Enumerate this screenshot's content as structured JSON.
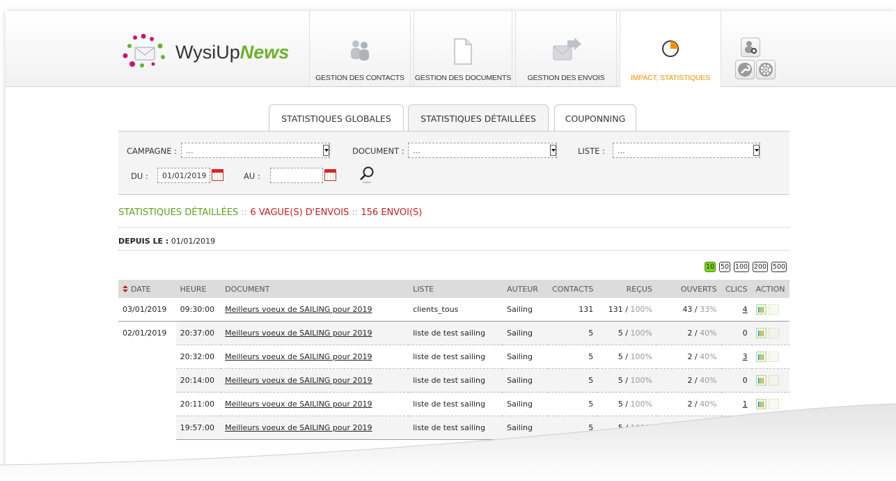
{
  "header": {
    "logo_text_main": "WysiUp",
    "logo_text_brand": "News",
    "nav": [
      {
        "label": "GESTION DES CONTACTS",
        "icon": "contacts-icon"
      },
      {
        "label": "GESTION DES DOCUMENTS",
        "icon": "document-icon"
      },
      {
        "label": "GESTION DES ENVOIS",
        "icon": "send-icon"
      },
      {
        "label": "IMPACT, STATISTIQUES",
        "icon": "pie-chart-icon",
        "active": true
      }
    ],
    "tools": [
      "user-add-icon",
      "wrench-icon",
      "gear-icon"
    ]
  },
  "subtabs": [
    {
      "label": "STATISTIQUES GLOBALES"
    },
    {
      "label": "STATISTIQUES DÉTAILLÉES",
      "active": true
    },
    {
      "label": "COUPONNING"
    }
  ],
  "filters": {
    "campagne_label": "CAMPAGNE :",
    "campagne_value": "...",
    "document_label": "DOCUMENT :",
    "document_value": "...",
    "liste_label": "LISTE :",
    "liste_value": "...",
    "du_label": "DU :",
    "du_value": "01/01/2019",
    "au_label": "AU :",
    "au_value": ""
  },
  "summary": {
    "title": "STATISTIQUES DÉTAILLÉES",
    "sep": "::",
    "waves": "6 VAGUE(S) D'ENVOIS",
    "sends": "156 ENVOI(S)"
  },
  "since": {
    "label": "DEPUIS LE :",
    "value": "01/01/2019"
  },
  "pager": [
    "10",
    "50",
    "100",
    "200",
    "500"
  ],
  "pager_active": "10",
  "table": {
    "headers": {
      "date": "DATE",
      "heure": "HEURE",
      "document": "DOCUMENT",
      "liste": "LISTE",
      "auteur": "AUTEUR",
      "contacts": "CONTACTS",
      "recus": "REÇUS",
      "ouverts": "OUVERTS",
      "clics": "CLICS",
      "action": "ACTION"
    },
    "rows": [
      {
        "date": "03/01/2019",
        "heure": "09:30:00",
        "document": "Meilleurs voeux de SAILING pour 2019",
        "liste": "clients_tous",
        "auteur": "Sailing",
        "contacts": "131",
        "recus_n": "131",
        "recus_p": "100%",
        "ouverts_n": "43",
        "ouverts_p": "33%",
        "clics": "4"
      },
      {
        "date": "02/01/2019",
        "heure": "20:37:00",
        "document": "Meilleurs voeux de SAILING pour 2019",
        "liste": "liste de test sailing",
        "auteur": "Sailing",
        "contacts": "5",
        "recus_n": "5",
        "recus_p": "100%",
        "ouverts_n": "2",
        "ouverts_p": "40%",
        "clics": "0"
      },
      {
        "date": "",
        "heure": "20:32:00",
        "document": "Meilleurs voeux de SAILING pour 2019",
        "liste": "liste de test sailing",
        "auteur": "Sailing",
        "contacts": "5",
        "recus_n": "5",
        "recus_p": "100%",
        "ouverts_n": "2",
        "ouverts_p": "40%",
        "clics": "3"
      },
      {
        "date": "",
        "heure": "20:14:00",
        "document": "Meilleurs voeux de SAILING pour 2019",
        "liste": "liste de test sailing",
        "auteur": "Sailing",
        "contacts": "5",
        "recus_n": "5",
        "recus_p": "100%",
        "ouverts_n": "2",
        "ouverts_p": "40%",
        "clics": "0"
      },
      {
        "date": "",
        "heure": "20:11:00",
        "document": "Meilleurs voeux de SAILING pour 2019",
        "liste": "liste de test sailing",
        "auteur": "Sailing",
        "contacts": "5",
        "recus_n": "5",
        "recus_p": "100%",
        "ouverts_n": "2",
        "ouverts_p": "40%",
        "clics": "1"
      },
      {
        "date": "",
        "heure": "19:57:00",
        "document": "Meilleurs voeux de SAILING pour 2019",
        "liste": "liste de test sailing",
        "auteur": "Sailing",
        "contacts": "5",
        "recus_n": "5",
        "recus_p": "100%",
        "ouverts_n": "",
        "ouverts_p": "",
        "clics": ""
      }
    ]
  }
}
